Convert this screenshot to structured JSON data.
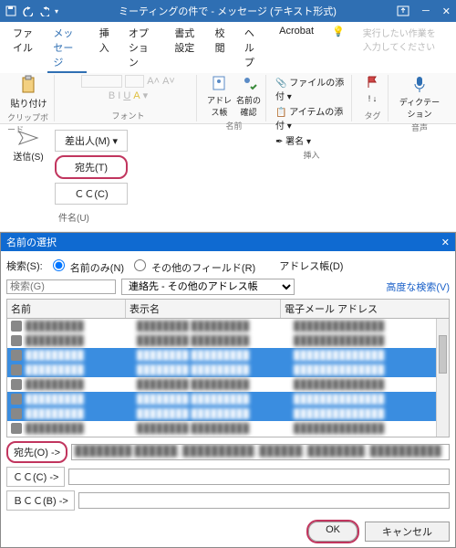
{
  "titlebar": {
    "title": "ミーティングの件で - メッセージ (テキスト形式)"
  },
  "tabs": {
    "file": "ファイル",
    "message": "メッセージ",
    "insert": "挿入",
    "options": "オプション",
    "format": "書式設定",
    "review": "校閲",
    "help": "ヘルプ",
    "acrobat": "Acrobat",
    "task_note": "実行したい作業を入力してください"
  },
  "ribbon": {
    "paste": "貼り付け",
    "clipboard": "クリップボード",
    "font_group": "フォント",
    "addrbook": "アドレス帳",
    "namecheck": "名前の確認",
    "names_group": "名前",
    "attach_file": "ファイルの添付",
    "attach_item": "アイテムの添付",
    "signature": "署名",
    "insert_group": "挿入",
    "tag_group": "タグ",
    "dictation": "ディクテーション",
    "voice_group": "音声"
  },
  "compose": {
    "from": "差出人(M)",
    "send": "送信(S)",
    "to": "宛先(T)",
    "cc": "ＣＣ(C)",
    "subject": "件名(U)"
  },
  "dialog": {
    "title": "名前の選択",
    "search_label": "検索(S):",
    "radio_name": "名前のみ(N)",
    "radio_other": "その他のフィールド(R)",
    "search_placeholder": "検索(G)",
    "addrbook_label": "アドレス帳(D)",
    "addrbook_value": "連絡先 - その他のアドレス帳",
    "advanced": "高度な検索(V)",
    "col_name": "名前",
    "col_display": "表示名",
    "col_email": "電子メール アドレス",
    "to_btn": "宛先(O) ->",
    "cc_btn": "ＣＣ(C) ->",
    "bcc_btn": "ＢＣＣ(B) ->",
    "ok": "OK",
    "cancel": "キャンセル"
  },
  "rows": [
    {
      "sel": false
    },
    {
      "sel": false
    },
    {
      "sel": true
    },
    {
      "sel": true
    },
    {
      "sel": false
    },
    {
      "sel": true
    },
    {
      "sel": true
    },
    {
      "sel": false
    }
  ]
}
